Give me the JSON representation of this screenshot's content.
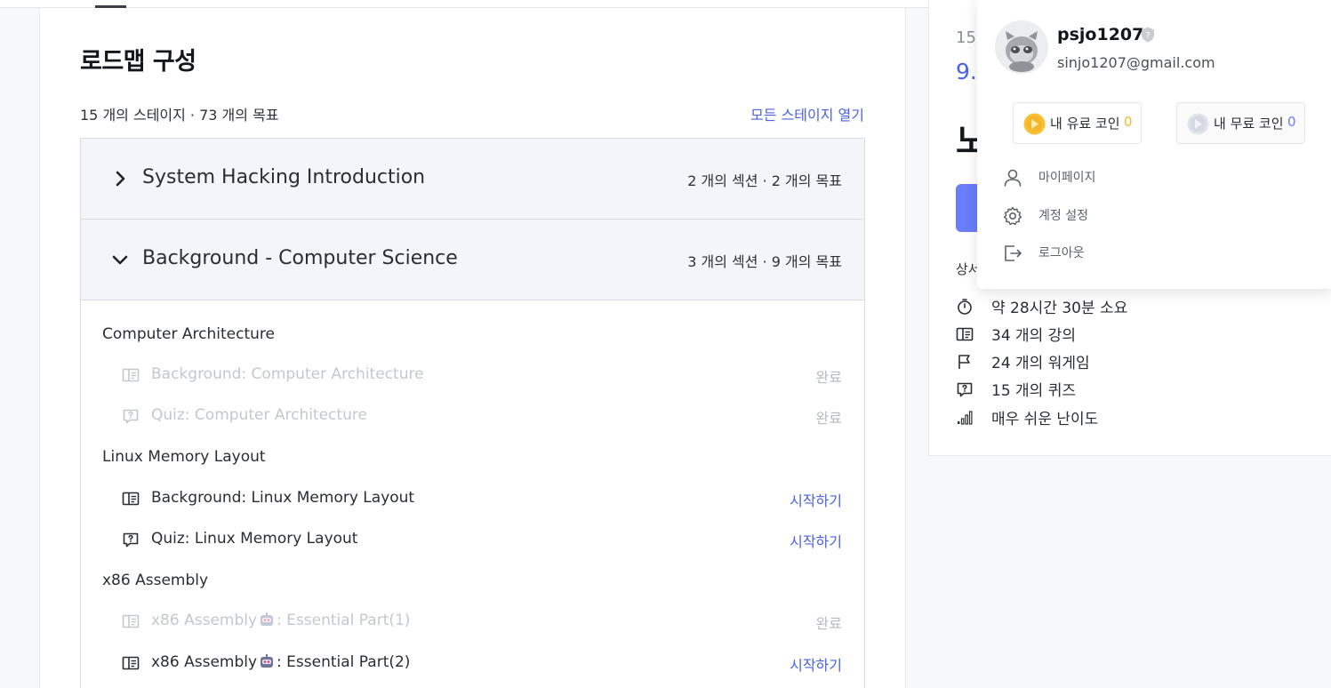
{
  "roadmap": {
    "title": "로드맵 구성",
    "summary": "15 개의 스테이지 · 73 개의 목표",
    "open_all": "모든 스테이지 열기",
    "stages": [
      {
        "title": "System Hacking Introduction",
        "meta": "2 개의 섹션 · 2 개의 목표",
        "expanded": false
      },
      {
        "title": "Background - Computer Science",
        "meta": "3 개의 섹션 · 9 개의 목표",
        "expanded": true
      }
    ],
    "sections": [
      {
        "title": "Computer Architecture",
        "goals": [
          {
            "icon": "lecture-icon",
            "label": "Background: Computer Architecture",
            "action": "완료",
            "done": true
          },
          {
            "icon": "quiz-icon",
            "label": "Quiz: Computer Architecture",
            "action": "완료",
            "done": true
          }
        ]
      },
      {
        "title": "Linux Memory Layout",
        "goals": [
          {
            "icon": "lecture-icon",
            "label": "Background: Linux Memory Layout",
            "action": "시작하기",
            "done": false
          },
          {
            "icon": "quiz-icon",
            "label": "Quiz: Linux Memory Layout",
            "action": "시작하기",
            "done": false
          }
        ]
      },
      {
        "title": "x86 Assembly",
        "goals": [
          {
            "icon": "lecture-icon",
            "label_prefix": "x86 Assembly",
            "label_suffix": ": Essential Part(1)",
            "action": "완료",
            "done": true
          },
          {
            "icon": "lecture-icon",
            "label_prefix": "x86 Assembly",
            "label_suffix": ": Essential Part(2)",
            "action": "시작하기",
            "done": false
          }
        ]
      }
    ]
  },
  "sidebar": {
    "frag_count": "15",
    "frag_price": "9.",
    "frag_heading": "노",
    "frag_details": "상서",
    "stats": [
      {
        "icon": "stopwatch-icon",
        "text": "약 28시간 30분 소요"
      },
      {
        "icon": "lecture-icon",
        "text": "34 개의 강의"
      },
      {
        "icon": "flag-icon",
        "text": "24 개의 워게임"
      },
      {
        "icon": "quiz-icon",
        "text": "15 개의 퀴즈"
      },
      {
        "icon": "difficulty-icon",
        "text": "매우 쉬운 난이도"
      }
    ]
  },
  "user_menu": {
    "username": "psjo1207",
    "email": "sinjo1207@gmail.com",
    "paid_coin_label": "내 유료 코인",
    "paid_coin_value": "0",
    "free_coin_label": "내 무료 코인",
    "free_coin_value": "0",
    "items": [
      {
        "icon": "user-icon",
        "label": "마이페이지"
      },
      {
        "icon": "gear-icon",
        "label": "계정 설정"
      },
      {
        "icon": "logout-icon",
        "label": "로그아웃"
      }
    ]
  },
  "colors": {
    "accent": "#4b63e6",
    "coin_paid": "#f5b62c",
    "coin_free": "#6a7dfa",
    "stage_bg": "#f4f5fb"
  }
}
